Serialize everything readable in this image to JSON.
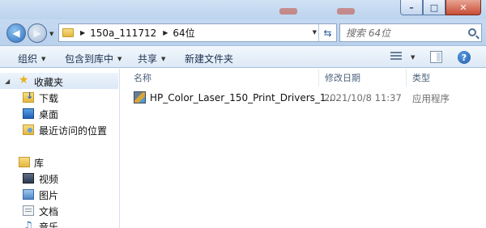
{
  "window": {
    "minimize": "–",
    "maximize": "□",
    "close": "✕"
  },
  "address": {
    "crumbs": [
      "150a_111712",
      "64位"
    ],
    "search_placeholder": "搜索 64位"
  },
  "toolbar": {
    "organize": "组织",
    "include_in_library": "包含到库中",
    "share": "共享",
    "new_folder": "新建文件夹",
    "help": "?"
  },
  "nav": {
    "favorites": "收藏夹",
    "favorites_items": [
      "下载",
      "桌面",
      "最近访问的位置"
    ],
    "libraries": "库",
    "library_items": [
      "视频",
      "图片",
      "文档",
      "音乐"
    ]
  },
  "columns": {
    "name": "名称",
    "modified": "修改日期",
    "type": "类型"
  },
  "files": [
    {
      "name": "HP_Color_Laser_150_Print_Drivers_1....",
      "modified": "2021/10/8 11:37",
      "type": "应用程序",
      "icon": "installer-icon"
    }
  ]
}
